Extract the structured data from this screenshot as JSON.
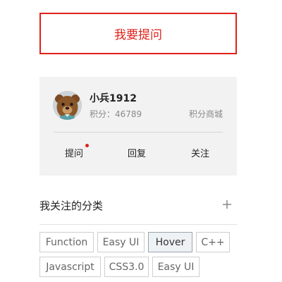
{
  "ask_button": {
    "label": "我要提问"
  },
  "profile": {
    "username": "小兵1912",
    "points_label": "积分：",
    "points_value": "46789",
    "points_mall": "积分商城",
    "actions": [
      {
        "label": "提问",
        "has_dot": true
      },
      {
        "label": "回复",
        "has_dot": false
      },
      {
        "label": "关注",
        "has_dot": false
      }
    ]
  },
  "followed_categories": {
    "title": "我关注的分类",
    "tags": [
      {
        "label": "Function",
        "active": false
      },
      {
        "label": "Easy UI",
        "active": false
      },
      {
        "label": "Hover",
        "active": true
      },
      {
        "label": "C++",
        "active": false
      },
      {
        "label": "Javascript",
        "active": false
      },
      {
        "label": "CSS3.0",
        "active": false
      },
      {
        "label": "Easy UI",
        "active": false
      }
    ]
  },
  "colors": {
    "accent": "#e0201a",
    "card_bg": "#f2f2f2"
  },
  "icons": {
    "add": "plus-icon",
    "notification": "red-dot"
  }
}
